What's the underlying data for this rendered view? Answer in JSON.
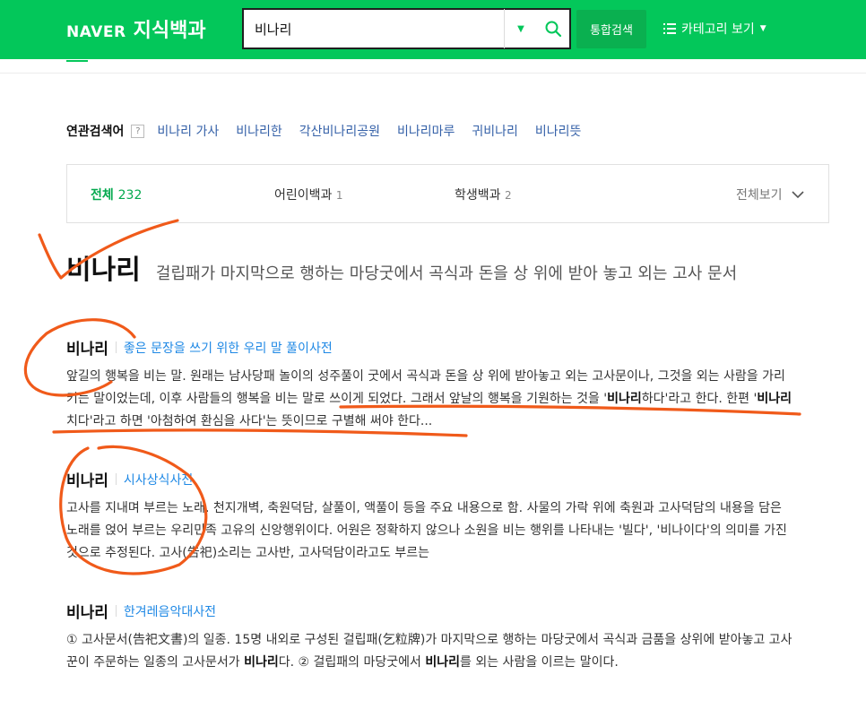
{
  "header": {
    "brand_naver": "NAVER",
    "brand_service": "지식백과",
    "search_value": "비나리",
    "total_search_label": "통합검색",
    "category_label": "카테고리 보기",
    "brand_color": "#03c75a"
  },
  "related": {
    "title": "연관검색어",
    "help": "?",
    "items": [
      "비나리 가사",
      "비나리한",
      "각산비나리공원",
      "비나리마루",
      "귀비나리",
      "비나리뜻"
    ]
  },
  "tabs": {
    "all_label": "전체",
    "all_count": "232",
    "tab2_label": "어린이백과",
    "tab2_count": "1",
    "tab3_label": "학생백과",
    "tab3_count": "2",
    "view_all_label": "전체보기"
  },
  "headline": {
    "term": "비나리",
    "desc": "걸립패가 마지막으로 행하는 마당굿에서 곡식과 돈을 상 위에 받아 놓고 외는 고사 문서"
  },
  "entries": [
    {
      "title": "비나리",
      "source": "좋은 문장을 쓰기 위한 우리 말 풀이사전",
      "body_parts": [
        "앞길의 행복을 비는 말. 원래는 남사당패 놀이의 성주풀이 굿에서 곡식과 돈을 상 위에 받아놓고 외는 고사문이나, 그것을 외는 사람을 가리키는 말이었는데, 이후 사람들의 행복을 비는 말로 쓰이게 되었다. 그래서 앞날의 행복을 기원하는 것을 '",
        "비나리",
        "하다'라고 한다. 한편 '",
        "비나리",
        "치다'라고 하면 '아첨하여 환심을 사다'는 뜻이므로 구별해 써야 한다..."
      ]
    },
    {
      "title": "비나리",
      "source": "시사상식사전",
      "body": "고사를 지내며 부르는 노래. 천지개벽, 축원덕담, 살풀이, 액풀이 등을 주요 내용으로 함. 사물의 가락 위에 축원과 고사덕담의 내용을 담은 노래를 얹어 부르는 우리민족 고유의 신앙행위이다. 어원은 정확하지 않으나 소원을 비는 행위를 나타내는 '빌다', '비나이다'의 의미를 가진 것으로 추정된다. 고사(告祀)소리는 고사반, 고사덕담이라고도 부르는"
    },
    {
      "title": "비나리",
      "source": "한겨레음악대사전",
      "body_parts": [
        "① 고사문서(告祀文書)의 일종. 15명 내외로 구성된 걸립패(乞粒牌)가 마지막으로 행하는 마당굿에서 곡식과 금품을 상위에 받아놓고 고사꾼이 주문하는 일종의 고사문서가 ",
        "비나리",
        "다. ② 걸립패의 마당굿에서 ",
        "비나리",
        "를 외는 사람을 이르는 말이다."
      ]
    }
  ],
  "annotation_color": "#f05a1a"
}
